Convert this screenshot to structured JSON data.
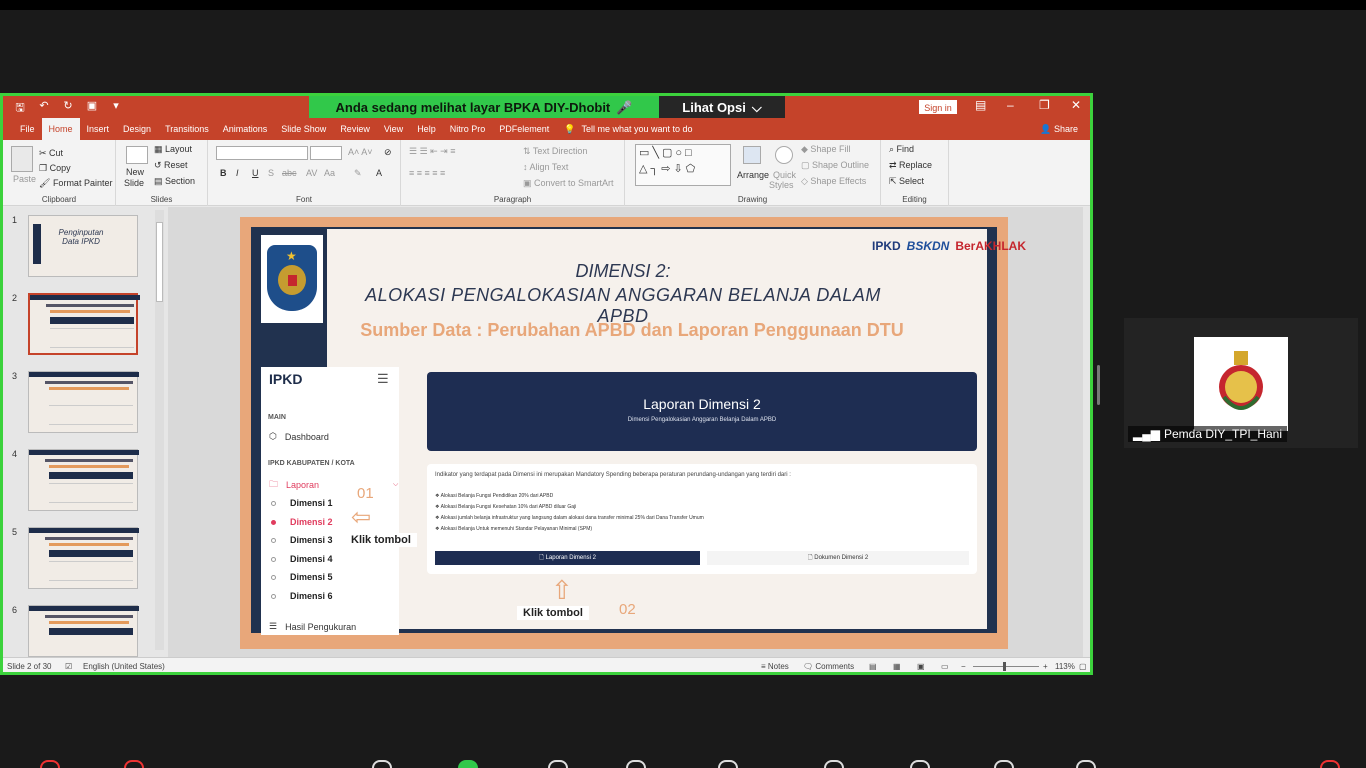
{
  "meeting": {
    "banner_text": "Anda sedang melihat layar  BPKA DIY-Dhobit",
    "view_options": "Lihat Opsi",
    "participant_name": "Pemda DIY_TPI_Hani"
  },
  "ppt": {
    "sign_in": "Sign in",
    "share": "Share",
    "tabs": [
      "File",
      "Home",
      "Insert",
      "Design",
      "Transitions",
      "Animations",
      "Slide Show",
      "Review",
      "View",
      "Help",
      "Nitro Pro",
      "PDFelement"
    ],
    "tell_me": "Tell me what you want to do",
    "ribbon": {
      "clipboard": {
        "label": "Clipboard",
        "paste": "Paste",
        "cut": "Cut",
        "copy": "Copy",
        "format_painter": "Format Painter"
      },
      "slides": {
        "label": "Slides",
        "new_slide": "New",
        "new_slide2": "Slide",
        "layout": "Layout",
        "reset": "Reset",
        "section": "Section"
      },
      "font": {
        "label": "Font"
      },
      "paragraph": {
        "label": "Paragraph",
        "text_direction": "Text Direction",
        "align_text": "Align Text",
        "convert": "Convert to SmartArt"
      },
      "drawing": {
        "label": "Drawing",
        "arrange": "Arrange",
        "quick_styles": "Quick",
        "quick_styles2": "Styles",
        "shape_fill": "Shape Fill",
        "shape_outline": "Shape Outline",
        "shape_effects": "Shape Effects"
      },
      "editing": {
        "label": "Editing",
        "find": "Find",
        "replace": "Replace",
        "select": "Select"
      }
    },
    "thumb_numbers": [
      "1",
      "2",
      "3",
      "4",
      "5",
      "6"
    ],
    "thumb1_title": "Penginputan Data IPKD",
    "status": {
      "slide_info": "Slide 2 of 30",
      "language": "English (United States)",
      "notes": "Notes",
      "comments": "Comments",
      "zoom": "113%"
    }
  },
  "slide": {
    "title1": "DIMENSI 2:",
    "title2": "ALOKASI PENGALOKASIAN ANGGARAN BELANJA DALAM APBD",
    "subtitle": "Sumber Data : Perubahan APBD dan Laporan Penggunaan DTU",
    "logos": [
      "IPKD",
      "BSKDN",
      "BerAKHLAK"
    ],
    "sidebar": {
      "brand": "IPKD",
      "main_section": "MAIN",
      "dashboard": "Dashboard",
      "kab_section": "IPKD KABUPATEN / KOTA",
      "laporan": "Laporan",
      "items": [
        "Dimensi 1",
        "Dimensi 2",
        "Dimensi 3",
        "Dimensi 4",
        "Dimensi 5",
        "Dimensi 6"
      ],
      "hasil": "Hasil Pengukuran"
    },
    "annotation1": {
      "num": "01",
      "label": "Klik tombol"
    },
    "annotation2": {
      "num": "02",
      "label": "Klik tombol"
    },
    "header_title": "Laporan Dimensi 2",
    "header_sub": "Dimensi Pengalokasian Anggaran Belanja Dalam APBD",
    "intro": "Indikator yang terdapat pada Dimensi ini merupakan Mandatory Spending beberapa peraturan perundang-undangan yang terdiri dari :",
    "bullets": [
      "Alokasi Belanja Fungsi Pendidikan 20% dari APBD",
      "Alokasi Belanja Fungsi Kesehatan 10% dari APBD diluar Gaji",
      "Alokasi jumlah belanja infrastruktur yang langsung dalam alokasi dana transfer minimal 25% dari Dana Transfer Umum",
      "Alokasi Belanja Untuk memenuhi Standar Pelayanan Minimal (SPM)"
    ],
    "btn_laporan": "Laporan Dimensi 2",
    "btn_dokumen": "Dokumen Dimensi 2"
  }
}
